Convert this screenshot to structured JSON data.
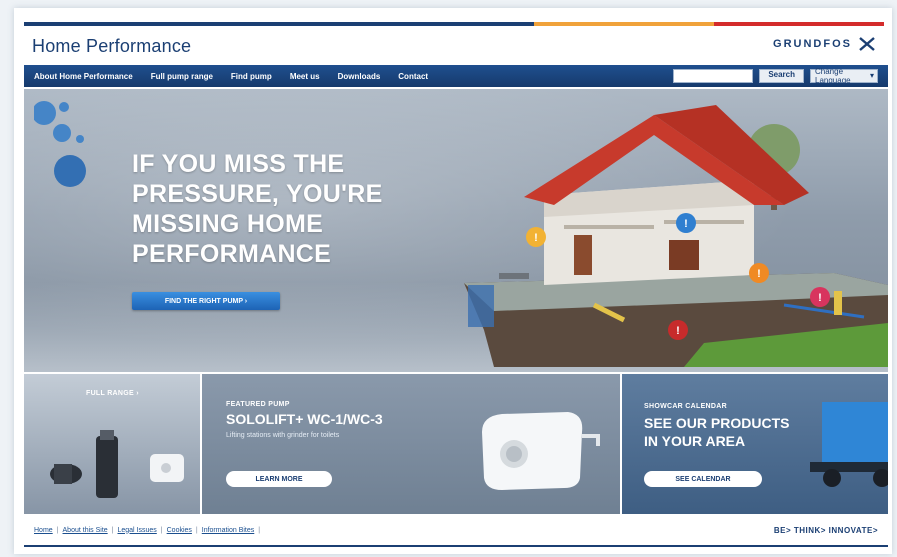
{
  "header": {
    "brand_title": "Home Performance",
    "logo_text": "GRUNDFOS"
  },
  "nav": {
    "items": [
      {
        "label": "About Home Performance"
      },
      {
        "label": "Full pump range"
      },
      {
        "label": "Find pump"
      },
      {
        "label": "Meet us"
      },
      {
        "label": "Downloads"
      },
      {
        "label": "Contact"
      }
    ],
    "search_placeholder": "",
    "search_button": "Search",
    "language_value": "Change Language"
  },
  "hero": {
    "heading_lines": [
      "IF YOU MISS THE",
      "PRESSURE, YOU'RE",
      "MISSING HOME",
      "PERFORMANCE"
    ],
    "cta_label": "FIND THE RIGHT PUMP ›"
  },
  "tiles": {
    "range_label": "FULL RANGE ›",
    "feature": {
      "kicker": "FEATURED PUMP",
      "title": "SOLOLIFT+ WC-1/WC-3",
      "subtitle": "Lifting stations with grinder for toilets",
      "button": "LEARN MORE"
    },
    "showcase": {
      "kicker": "SHOWCAR CALENDAR",
      "title_lines": [
        "SEE OUR PRODUCTS",
        "IN YOUR AREA"
      ],
      "button": "SEE CALENDAR"
    }
  },
  "footer": {
    "links": [
      "Home",
      "About this Site",
      "Legal Issues",
      "Cookies",
      "Information Bites"
    ],
    "tagline": "BE> THINK> INNOVATE>"
  },
  "colors": {
    "brand_navy": "#1b3f73",
    "accent_orange": "#f0a23a",
    "accent_red": "#d42b2b",
    "cta_blue": "#1d63b5"
  }
}
